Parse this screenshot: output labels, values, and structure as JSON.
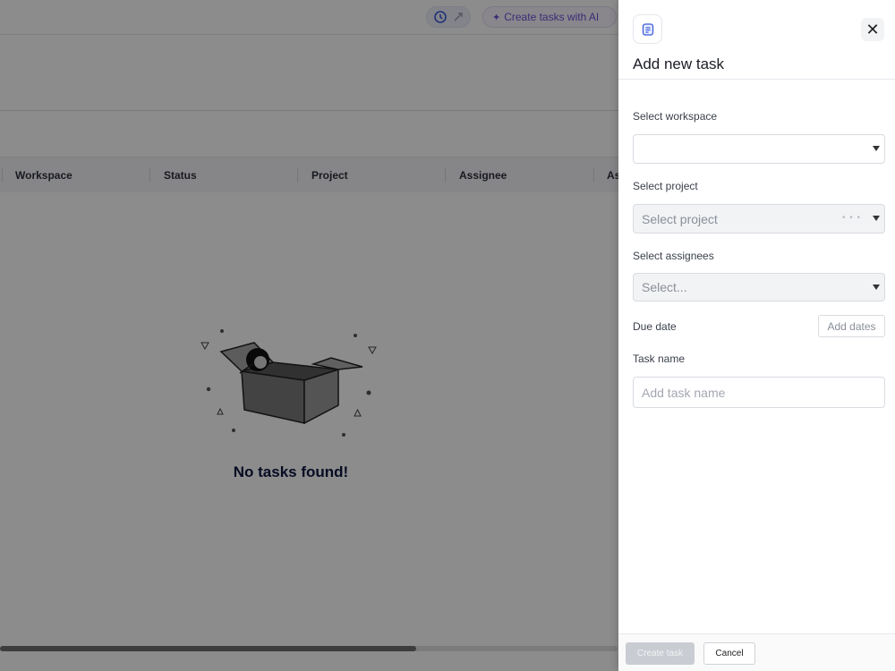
{
  "toolbar": {
    "ai_button_label": "Create tasks with AI",
    "tool_icons": [
      "refresh-icon",
      "collapse-icon"
    ]
  },
  "table": {
    "columns": [
      "Workspace",
      "Status",
      "Project",
      "Assignee",
      "As"
    ]
  },
  "empty_state": {
    "message": "No tasks found!",
    "illustration": "empty-box-illustration"
  },
  "panel": {
    "icon": "task-doc-icon",
    "title": "Add new task",
    "workspace_label": "Select workspace",
    "workspace_value": "",
    "project_label": "Select project",
    "project_placeholder": "Select project",
    "assignees_label": "Select assignees",
    "assignees_placeholder": "Select...",
    "due_date_label": "Due date",
    "due_date_button": "Add dates",
    "task_name_label": "Task name",
    "task_name_placeholder": "Add task name",
    "create_button": "Create task",
    "cancel_button": "Cancel"
  },
  "colors": {
    "overlay": "#000000",
    "accent_ai": "#6d4fd8",
    "empty_title": "#0b1740"
  }
}
